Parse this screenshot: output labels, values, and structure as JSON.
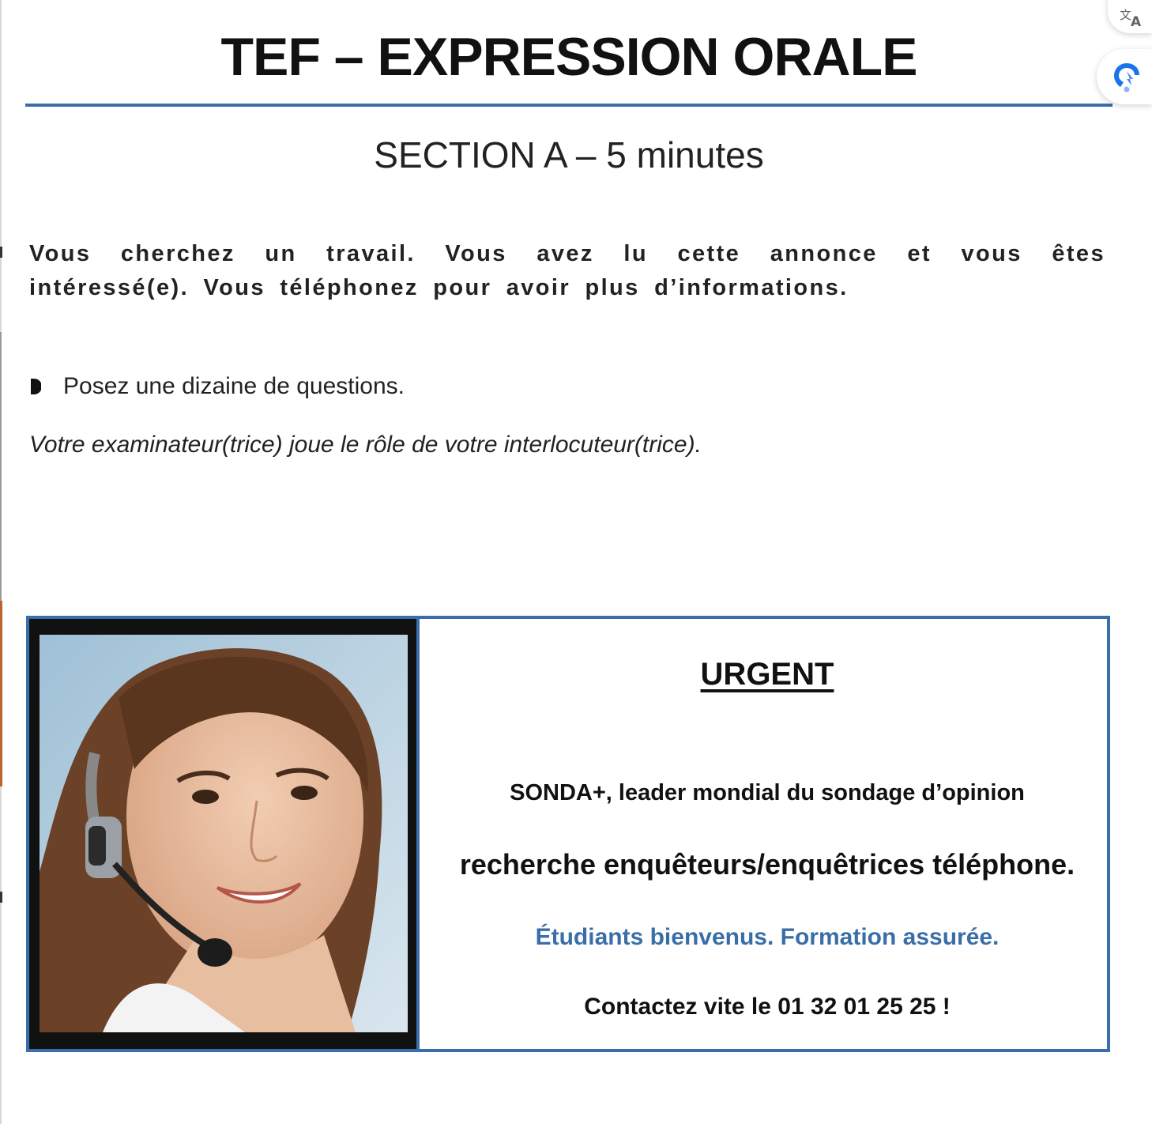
{
  "document": {
    "title": "TEF – EXPRESSION ORALE",
    "section": "SECTION A – 5 minutes",
    "instructions": "Vous cherchez un travail. Vous avez lu cette annonce et vous êtes intéressé(e). Vous téléphonez pour avoir plus d’informations.",
    "task": "Posez une dizaine de questions.",
    "note": "Votre examinateur(trice) joue le rôle de votre interlocuteur(trice)."
  },
  "ad": {
    "heading": "URGENT",
    "line1": "SONDA+, leader mondial du sondage d’opinion",
    "line2": "recherche enquêteurs/enquêtrices téléphone.",
    "line3": "Étudiants bienvenus. Formation assurée.",
    "line4": "Contactez vite le 01 32 01 25 25 !",
    "photo": "woman-with-headset-photo"
  },
  "colors": {
    "accent_blue": "#3a6ea8",
    "text": "#1a1a1a"
  },
  "floating_buttons": {
    "translate_icon": "translate-icon",
    "assistant_icon": "assistant-icon"
  }
}
